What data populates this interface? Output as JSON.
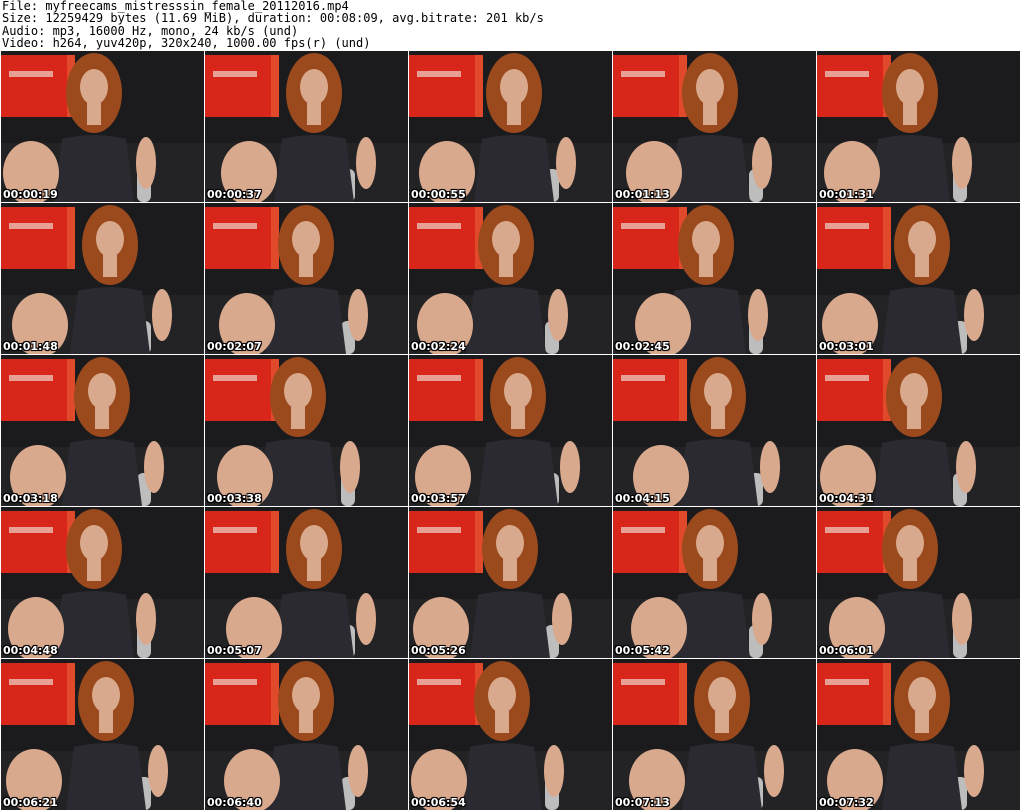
{
  "header": {
    "file_line": "File: myfreecams_mistresssin_female_20112016.mp4",
    "size_line": "Size: 12259429 bytes (11.69 MiB), duration: 00:08:09, avg.bitrate: 201 kb/s",
    "audio_line": "Audio: mp3, 16000 Hz, mono, 24 kb/s (und)",
    "video_line": "Video: h264, yuv420p, 320x240, 1000.00 fps(r) (und)"
  },
  "thumbnails": [
    {
      "time": "00:00:19"
    },
    {
      "time": "00:00:37"
    },
    {
      "time": "00:00:55"
    },
    {
      "time": "00:01:13"
    },
    {
      "time": "00:01:31"
    },
    {
      "time": "00:01:48"
    },
    {
      "time": "00:02:07"
    },
    {
      "time": "00:02:24"
    },
    {
      "time": "00:02:45"
    },
    {
      "time": "00:03:01"
    },
    {
      "time": "00:03:18"
    },
    {
      "time": "00:03:38"
    },
    {
      "time": "00:03:57"
    },
    {
      "time": "00:04:15"
    },
    {
      "time": "00:04:31"
    },
    {
      "time": "00:04:48"
    },
    {
      "time": "00:05:07"
    },
    {
      "time": "00:05:26"
    },
    {
      "time": "00:05:42"
    },
    {
      "time": "00:06:01"
    },
    {
      "time": "00:06:21"
    },
    {
      "time": "00:06:40"
    },
    {
      "time": "00:06:54"
    },
    {
      "time": "00:07:13"
    },
    {
      "time": "00:07:32"
    }
  ],
  "colors": {
    "background": "#ffffff",
    "header_text": "#000000",
    "timestamp_text": "#ffffff",
    "wall": "#1b1b1d",
    "sign": "#d8261a",
    "hair": "#9a4a1c",
    "skin": "#d9a98e",
    "dress": "#2a2a30"
  }
}
